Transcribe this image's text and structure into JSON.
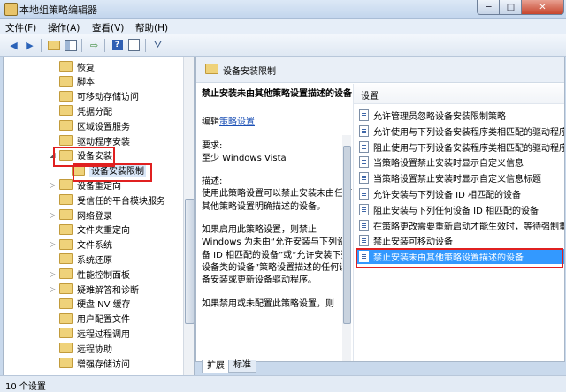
{
  "window": {
    "title": "本地组策略编辑器",
    "buttons": {
      "minimize": "─",
      "maximize": "□",
      "close": "✕"
    }
  },
  "menu": [
    "文件(F)",
    "操作(A)",
    "查看(V)",
    "帮助(H)"
  ],
  "toolbar": [
    "back-icon",
    "forward-icon",
    "up-folder-icon",
    "show-hide-tree-icon",
    "export-icon",
    "help-icon",
    "properties-icon",
    "filter-icon"
  ],
  "tree": [
    {
      "label": "恢复",
      "arrow": ""
    },
    {
      "label": "脚本",
      "arrow": ""
    },
    {
      "label": "可移动存储访问",
      "arrow": ""
    },
    {
      "label": "凭据分配",
      "arrow": ""
    },
    {
      "label": "区域设置服务",
      "arrow": ""
    },
    {
      "label": "驱动程序安装",
      "arrow": ""
    },
    {
      "label": "设备安装",
      "arrow": "◢"
    },
    {
      "label": "设备安装限制",
      "arrow": "",
      "selected": true
    },
    {
      "label": "设备重定向",
      "arrow": "▷"
    },
    {
      "label": "受信任的平台模块服务",
      "arrow": ""
    },
    {
      "label": "网络登录",
      "arrow": "▷"
    },
    {
      "label": "文件夹重定向",
      "arrow": ""
    },
    {
      "label": "文件系统",
      "arrow": "▷"
    },
    {
      "label": "系统还原",
      "arrow": ""
    },
    {
      "label": "性能控制面板",
      "arrow": "▷"
    },
    {
      "label": "疑难解答和诊断",
      "arrow": "▷"
    },
    {
      "label": "硬盘 NV 缓存",
      "arrow": ""
    },
    {
      "label": "用户配置文件",
      "arrow": ""
    },
    {
      "label": "远程过程调用",
      "arrow": ""
    },
    {
      "label": "远程协助",
      "arrow": ""
    },
    {
      "label": "增强存储访问",
      "arrow": ""
    }
  ],
  "right": {
    "header": "设备安装限制",
    "desc": {
      "title": "禁止安装未由其他策略设置描述的设备",
      "edit_prefix": "编辑",
      "edit_link": "策略设置",
      "req_label": "要求:",
      "req_value": "至少 Windows Vista",
      "desc_label": "描述:",
      "desc_p1": "使用此策略设置可以禁止安装未由任何其他策略设置明确描述的设备。",
      "desc_p2": "如果启用此策略设置，则禁止 Windows 为未由“允许安装与下列设备 ID 相匹配的设备”或“允许安装下列设备类的设备”策略设置描述的任何设备安装或更新设备驱动程序。",
      "desc_p3": "如果禁用或未配置此策略设置，则"
    },
    "settings_label": "设置",
    "settings": [
      "允许管理员忽略设备安装限制策略",
      "允许使用与下列设备安装程序类相匹配的驱动程序",
      "阻止使用与下列设备安装程序类相匹配的驱动程序",
      "当策略设置禁止安装时显示自定义信息",
      "当策略设置禁止安装时显示自定义信息标题",
      "允许安装与下列设备 ID 相匹配的设备",
      "阻止安装与下列任何设备 ID 相匹配的设备",
      "在策略更改需要重新启动才能生效时，等待强制重",
      "禁止安装可移动设备",
      "禁止安装未由其他策略设置描述的设备"
    ],
    "selected_index": 9
  },
  "tabs": {
    "extended": "扩展",
    "standard": "标准"
  },
  "status": "10 个设置"
}
